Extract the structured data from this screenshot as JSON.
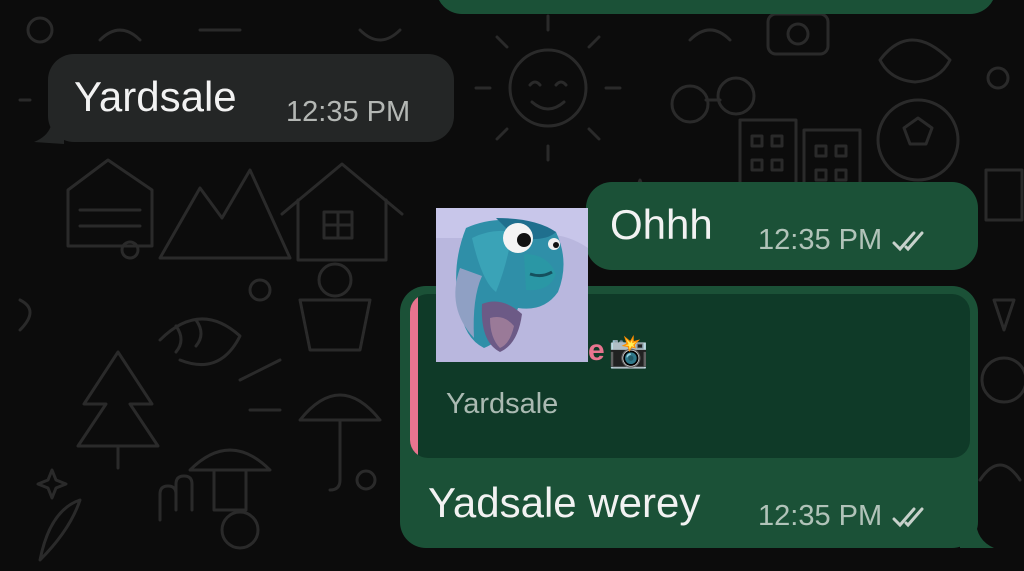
{
  "messages": [
    {
      "id": "m1",
      "direction": "incoming",
      "text": "Yardsale",
      "time": "12:35 PM"
    },
    {
      "id": "m2",
      "direction": "outgoing",
      "text": "Ohhh",
      "time": "12:35 PM",
      "status": "read"
    },
    {
      "id": "m3",
      "direction": "outgoing",
      "text": "Yadsale werey",
      "time": "12:35 PM",
      "status": "read",
      "reply": {
        "author_suffix": "e",
        "author_emoji": "📸",
        "quoted_text": "Yardsale",
        "accent_color": "#e8748f"
      }
    }
  ],
  "sticker": {
    "description": "blue cartoon fish sticker"
  },
  "colors": {
    "incoming_bubble": "#242626",
    "outgoing_bubble": "#1b5137",
    "quote_background": "#0f3a28",
    "read_ticks": "#c7d1cb"
  }
}
